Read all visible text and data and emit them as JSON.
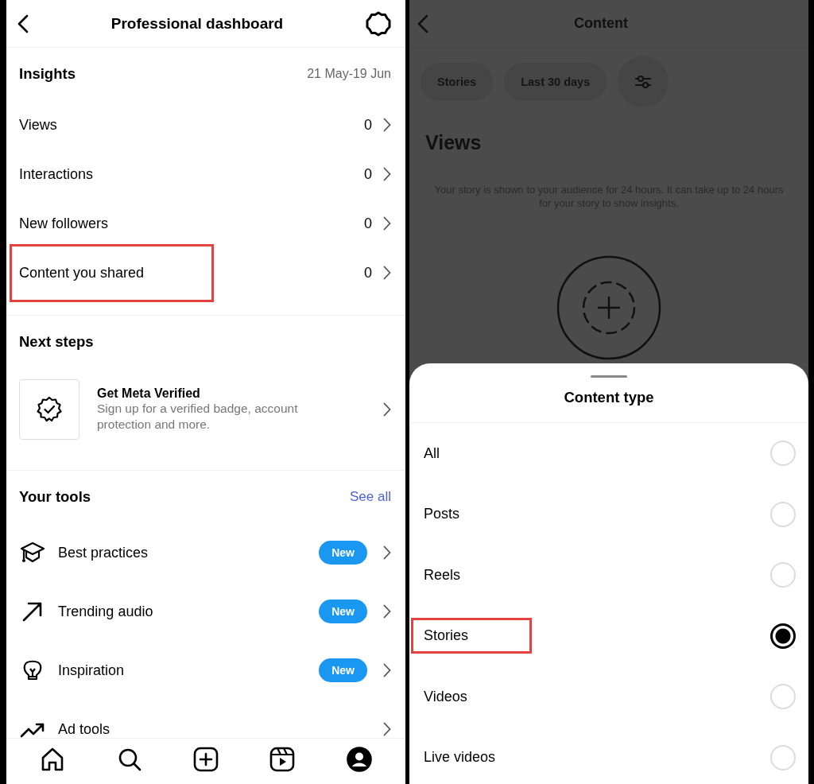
{
  "dashboard": {
    "title": "Professional dashboard",
    "insights": {
      "heading": "Insights",
      "date_range": "21 May-19 Jun",
      "rows": [
        {
          "label": "Views",
          "value": "0",
          "highlighted": false
        },
        {
          "label": "Interactions",
          "value": "0",
          "highlighted": false
        },
        {
          "label": "New followers",
          "value": "0",
          "highlighted": false
        },
        {
          "label": "Content you shared",
          "value": "0",
          "highlighted": true
        }
      ]
    },
    "next_steps": {
      "heading": "Next steps",
      "card": {
        "title": "Get Meta Verified",
        "description": "Sign up for a verified badge, account protection and more."
      }
    },
    "tools": {
      "heading": "Your tools",
      "link": "See all",
      "items": [
        {
          "label": "Best practices",
          "badge": "New"
        },
        {
          "label": "Trending audio",
          "badge": "New"
        },
        {
          "label": "Inspiration",
          "badge": "New"
        },
        {
          "label": "Ad tools"
        }
      ]
    },
    "bottom_nav": [
      {
        "selected": false
      },
      {
        "selected": false
      },
      {
        "selected": false
      },
      {
        "selected": false
      },
      {
        "selected": true
      }
    ]
  },
  "content": {
    "title": "Content",
    "filters": [
      {
        "label": "Stories"
      },
      {
        "label": "Last 30 days"
      }
    ],
    "section_title": "Views",
    "message": "Your story is shown to your audience for 24 hours. It can take up to 24 hours for your story to show insights.",
    "sheet": {
      "title": "Content type",
      "options": [
        {
          "label": "All",
          "selected": false,
          "highlighted": false
        },
        {
          "label": "Posts",
          "selected": false,
          "highlighted": false
        },
        {
          "label": "Reels",
          "selected": false,
          "highlighted": false
        },
        {
          "label": "Stories",
          "selected": true,
          "highlighted": true
        },
        {
          "label": "Videos",
          "selected": false,
          "highlighted": false
        },
        {
          "label": "Live videos",
          "selected": false,
          "highlighted": false
        }
      ]
    }
  }
}
